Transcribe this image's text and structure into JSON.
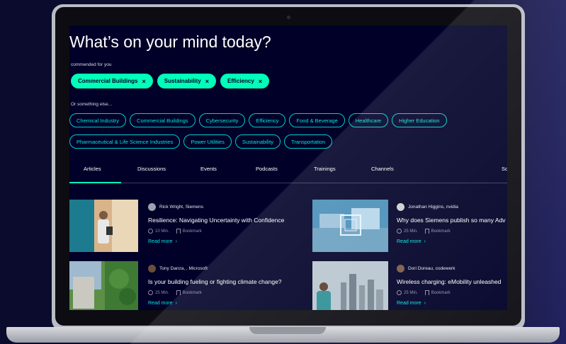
{
  "page": {
    "eyebrow": "",
    "headline": "hat’s on your mind today?",
    "recommended_label": "commended for you",
    "something_else_label": "something else...",
    "recommended": [
      {
        "label": "Commercial Buildings",
        "close": "×"
      },
      {
        "label": "Sustainability",
        "close": "×"
      },
      {
        "label": "Efficiency",
        "close": "×"
      }
    ],
    "topics_row1": [
      "Chemical Industry",
      "Commercial Buildings",
      "Cybersecurity",
      "Efficiency",
      "Food & Beverage",
      "Healthcare",
      "Higher Education"
    ],
    "topics_row2": [
      "Pharmaceutical & Life Science Industries",
      "Power Utilities",
      "Sustainability",
      "Transportation"
    ],
    "tabs": [
      "Articles",
      "Discussions",
      "Events",
      "Podcasts",
      "Trainings",
      "Channels",
      "So"
    ],
    "articles": [
      {
        "author": "Rick Wright, Siemens",
        "title": "Resilience: Navigating Uncertainty with Confidence",
        "duration": "10 Min.",
        "bookmark": "Bookmark",
        "read_more": "Read more"
      },
      {
        "author": "Jonathan Higgins, nvidia",
        "title": "Why does Siemens publish so many Adv",
        "duration": "25 Min.",
        "bookmark": "Bookmark",
        "read_more": "Read more"
      },
      {
        "author": "Tony Danza, , Microsoft",
        "title": "Is your building fueling or fighting climate change?",
        "duration": "25 Min.",
        "bookmark": "Bookmark",
        "read_more": "Read more"
      },
      {
        "author": "Dori Doreau, codewerk",
        "title": "Wireless charging: eMobility unleashed",
        "duration": "25 Min.",
        "bookmark": "Bookmark",
        "read_more": "Read more"
      }
    ]
  },
  "colors": {
    "accent": "#00ffb9",
    "outline": "#00cccc",
    "background": "#000028"
  }
}
